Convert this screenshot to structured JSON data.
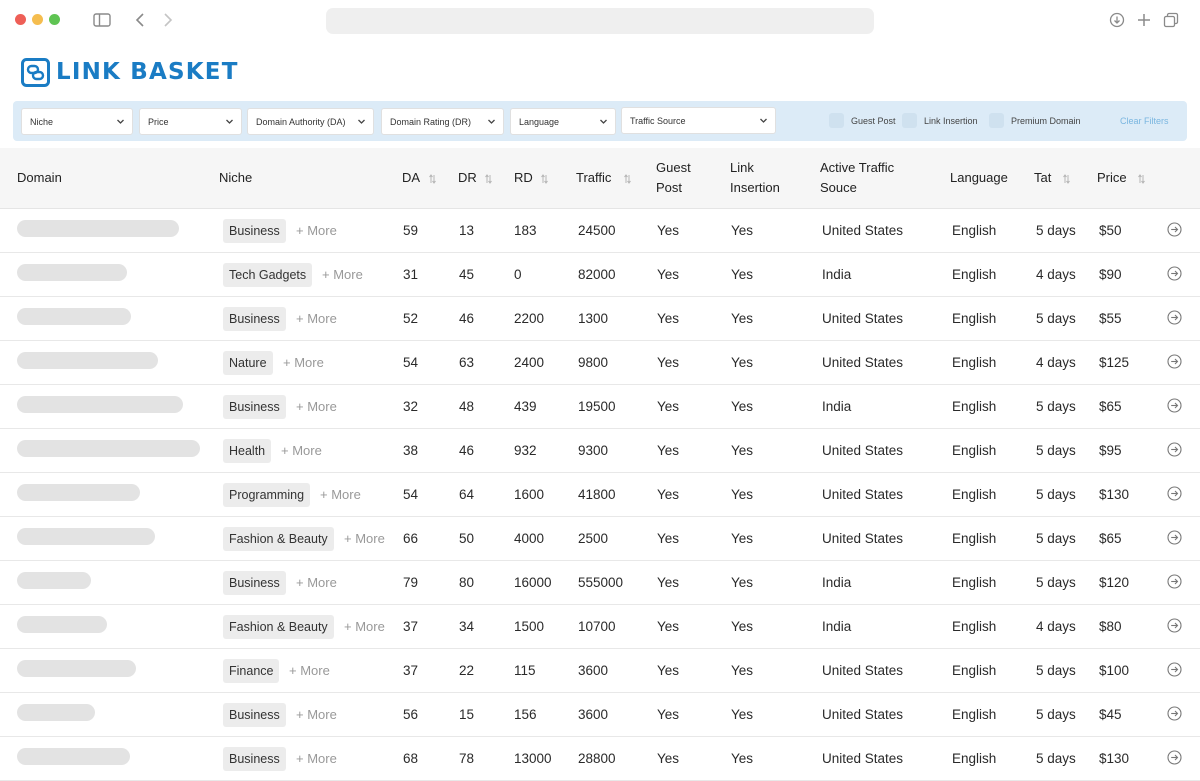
{
  "app": {
    "logo_text": "LINK BASKET"
  },
  "filters": {
    "niche": "Niche",
    "price": "Price",
    "da": "Domain Authority (DA)",
    "dr": "Domain Rating (DR)",
    "language": "Language",
    "traffic_source": "Traffic Source",
    "guest_post": "Guest Post",
    "link_insertion": "Link Insertion",
    "premium_domain": "Premium Domain",
    "clear": "Clear Filters"
  },
  "table": {
    "headers": {
      "domain": "Domain",
      "niche": "Niche",
      "da": "DA",
      "dr": "DR",
      "rd": "RD",
      "traffic": "Traffic",
      "guest_post_1": "Guest",
      "guest_post_2": "Post",
      "link_insertion_1": "Link",
      "link_insertion_2": "Insertion",
      "active_traffic_1": "Active Traffic",
      "active_traffic_2": "Souce",
      "language": "Language",
      "tat": "Tat",
      "price": "Price"
    },
    "more_label": "+ More",
    "rows": [
      {
        "niche": "Business",
        "da": "59",
        "dr": "13",
        "rd": "183",
        "traffic": "24500",
        "guest_post": "Yes",
        "link_insertion": "Yes",
        "source": "United States",
        "language": "English",
        "tat": "5 days",
        "price": "$50"
      },
      {
        "niche": "Tech Gadgets",
        "da": "31",
        "dr": "45",
        "rd": "0",
        "traffic": "82000",
        "guest_post": "Yes",
        "link_insertion": "Yes",
        "source": "India",
        "language": "English",
        "tat": "4 days",
        "price": "$90"
      },
      {
        "niche": "Business",
        "da": "52",
        "dr": "46",
        "rd": "2200",
        "traffic": "1300",
        "guest_post": "Yes",
        "link_insertion": "Yes",
        "source": "United States",
        "language": "English",
        "tat": "5 days",
        "price": "$55"
      },
      {
        "niche": "Nature",
        "da": "54",
        "dr": "63",
        "rd": "2400",
        "traffic": "9800",
        "guest_post": "Yes",
        "link_insertion": "Yes",
        "source": "United States",
        "language": "English",
        "tat": "4 days",
        "price": "$125"
      },
      {
        "niche": "Business",
        "da": "32",
        "dr": "48",
        "rd": "439",
        "traffic": "19500",
        "guest_post": "Yes",
        "link_insertion": "Yes",
        "source": "India",
        "language": "English",
        "tat": "5 days",
        "price": "$65"
      },
      {
        "niche": "Health",
        "da": "38",
        "dr": "46",
        "rd": "932",
        "traffic": "9300",
        "guest_post": "Yes",
        "link_insertion": "Yes",
        "source": "United States",
        "language": "English",
        "tat": "5 days",
        "price": "$95"
      },
      {
        "niche": "Programming",
        "da": "54",
        "dr": "64",
        "rd": "1600",
        "traffic": "41800",
        "guest_post": "Yes",
        "link_insertion": "Yes",
        "source": "United States",
        "language": "English",
        "tat": "5 days",
        "price": "$130"
      },
      {
        "niche": "Fashion & Beauty",
        "da": "66",
        "dr": "50",
        "rd": "4000",
        "traffic": "2500",
        "guest_post": "Yes",
        "link_insertion": "Yes",
        "source": "United States",
        "language": "English",
        "tat": "5 days",
        "price": "$65"
      },
      {
        "niche": "Business",
        "da": "79",
        "dr": "80",
        "rd": "16000",
        "traffic": "555000",
        "guest_post": "Yes",
        "link_insertion": "Yes",
        "source": "India",
        "language": "English",
        "tat": "5 days",
        "price": "$120"
      },
      {
        "niche": "Fashion & Beauty",
        "da": "37",
        "dr": "34",
        "rd": "1500",
        "traffic": "10700",
        "guest_post": "Yes",
        "link_insertion": "Yes",
        "source": "India",
        "language": "English",
        "tat": "4 days",
        "price": "$80"
      },
      {
        "niche": "Finance",
        "da": "37",
        "dr": "22",
        "rd": "115",
        "traffic": "3600",
        "guest_post": "Yes",
        "link_insertion": "Yes",
        "source": "United States",
        "language": "English",
        "tat": "5 days",
        "price": "$100"
      },
      {
        "niche": "Business",
        "da": "56",
        "dr": "15",
        "rd": "156",
        "traffic": "3600",
        "guest_post": "Yes",
        "link_insertion": "Yes",
        "source": "United States",
        "language": "English",
        "tat": "5 days",
        "price": "$45"
      },
      {
        "niche": "Business",
        "da": "68",
        "dr": "78",
        "rd": "13000",
        "traffic": "28800",
        "guest_post": "Yes",
        "link_insertion": "Yes",
        "source": "United States",
        "language": "English",
        "tat": "5 days",
        "price": "$130"
      }
    ]
  }
}
